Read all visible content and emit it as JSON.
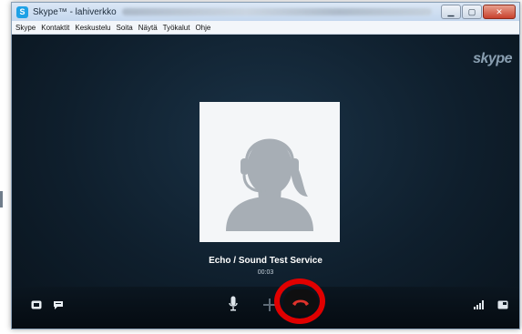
{
  "window": {
    "app_icon_letter": "S",
    "title": "Skype™ - lahiverkko"
  },
  "menu": {
    "items": [
      "Skype",
      "Kontaktit",
      "Keskustelu",
      "Soita",
      "Näytä",
      "Työkalut",
      "Ohje"
    ]
  },
  "brand": {
    "logo": "skype"
  },
  "call": {
    "name": "Echo / Sound Test Service",
    "duration": "00:03"
  },
  "icons": {
    "dialpad": "dialpad-icon",
    "chat": "chat-icon",
    "microphone": "microphone-icon",
    "add": "add-icon",
    "hangup": "hang-up-icon",
    "signal": "signal-icon",
    "fullscreen": "fullscreen-icon"
  },
  "colors": {
    "hangup_red": "#e0332c",
    "highlight_ring": "#e00000",
    "stage_bg": "#0f1f2d"
  }
}
